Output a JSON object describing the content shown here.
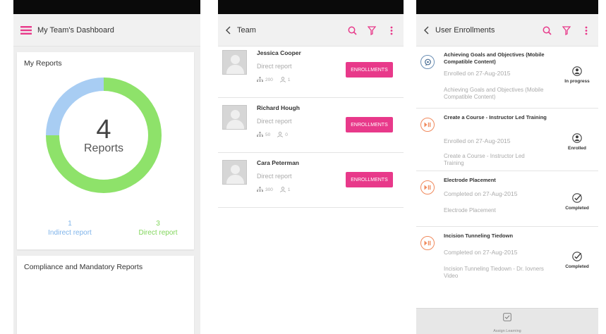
{
  "panel1": {
    "title": "My Team's Dashboard",
    "reports_card": {
      "title": "My Reports",
      "total": "4",
      "total_label": "Reports",
      "indirect": {
        "count": "1",
        "label": "Indirect report"
      },
      "direct": {
        "count": "3",
        "label": "Direct report"
      }
    },
    "compliance_card": {
      "title": "Compliance and Mandatory Reports"
    }
  },
  "panel2": {
    "title": "Team",
    "members": [
      {
        "name": "Jessica Cooper",
        "role": "Direct report",
        "stat1": "200",
        "stat2": "1",
        "button": "ENROLLMENTS"
      },
      {
        "name": "Richard Hough",
        "role": "Direct report",
        "stat1": "50",
        "stat2": "0",
        "button": "ENROLLMENTS"
      },
      {
        "name": "Cara Peterman",
        "role": "Direct report",
        "stat1": "300",
        "stat2": "1",
        "button": "ENROLLMENTS"
      }
    ]
  },
  "panel3": {
    "title": "User Enrollments",
    "courses": [
      {
        "title": "Achieving Goals and Objectives (Mobile Compatible Content)",
        "date": "Enrolled on 27-Aug-2015",
        "desc": "Achieving Goals and Objectives (Mobile Compatible Content)",
        "status": "In progress",
        "icon": "chat-bubble-icon",
        "status_icon": "user-circle-icon"
      },
      {
        "title": "Create a Course - Instructor Led Training",
        "date": "Enrolled on 27-Aug-2015",
        "desc": "Create a Course - Instructor Led Training",
        "status": "Enrolled",
        "icon": "play-pause-icon",
        "status_icon": "user-circle-icon"
      },
      {
        "title": "Electrode Placement",
        "date": "Completed on 27-Aug-2015",
        "desc": "Electrode Placement",
        "status": "Completed",
        "icon": "play-pause-icon",
        "status_icon": "check-circle-icon"
      },
      {
        "title": "Incision Tunneling Tiedown",
        "date": "Completed on 27-Aug-2015",
        "desc": "Incision Tunneling Tiedown - Dr. Iovners Video",
        "status": "Completed",
        "icon": "play-pause-icon",
        "status_icon": "check-circle-icon"
      }
    ],
    "footer": {
      "label": "Assign Learning"
    }
  },
  "colors": {
    "accent_pink": "#e8398a",
    "donut_direct": "#8ee26a",
    "donut_indirect": "#a8cdf3",
    "indirect_text": "#7fb4ea",
    "direct_text": "#82d65c",
    "course_icon_orange": "#f08a5d"
  },
  "chart_data": {
    "type": "pie",
    "title": "My Reports",
    "categories": [
      "Indirect report",
      "Direct report"
    ],
    "values": [
      1,
      3
    ]
  }
}
